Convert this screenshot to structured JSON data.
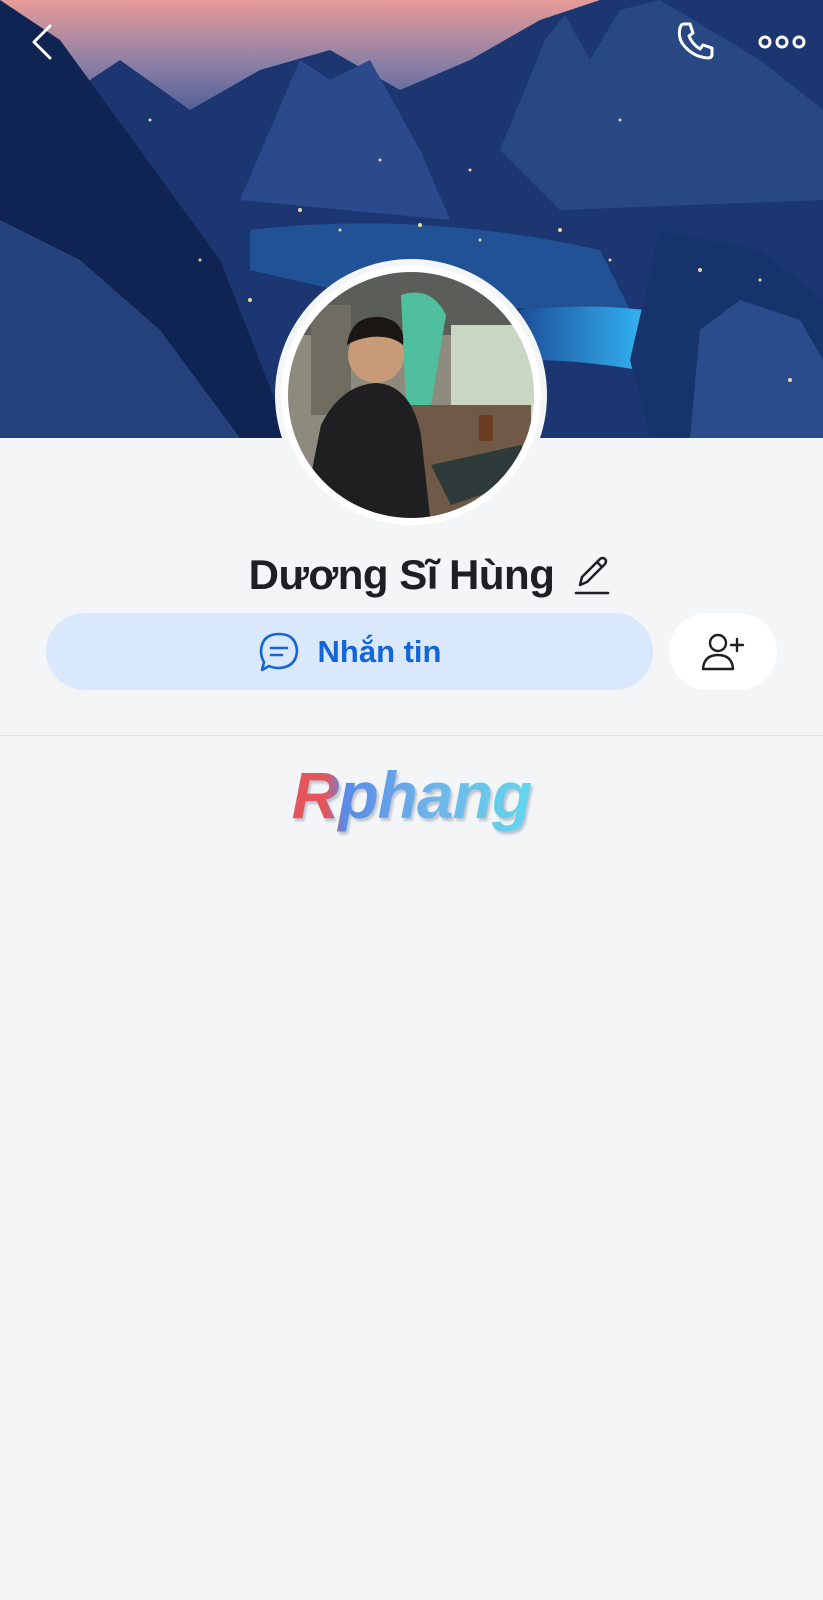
{
  "header": {
    "back_icon": "chevron-left-icon",
    "call_icon": "phone-icon",
    "more_icon": "more-horizontal-icon"
  },
  "profile": {
    "name": "Dương Sĩ Hùng",
    "edit_icon": "pencil-icon",
    "avatar": "profile-photo",
    "cover": "mountain-night-cover"
  },
  "actions": {
    "message_label": "Nhắn tin",
    "message_icon": "chat-bubble-icon",
    "add_friend_icon": "add-user-icon"
  },
  "brand": {
    "text": "Rphang"
  },
  "colors": {
    "background": "#f3f5f7",
    "accent": "#1565d8",
    "message_button_bg": "#dae8fc"
  }
}
